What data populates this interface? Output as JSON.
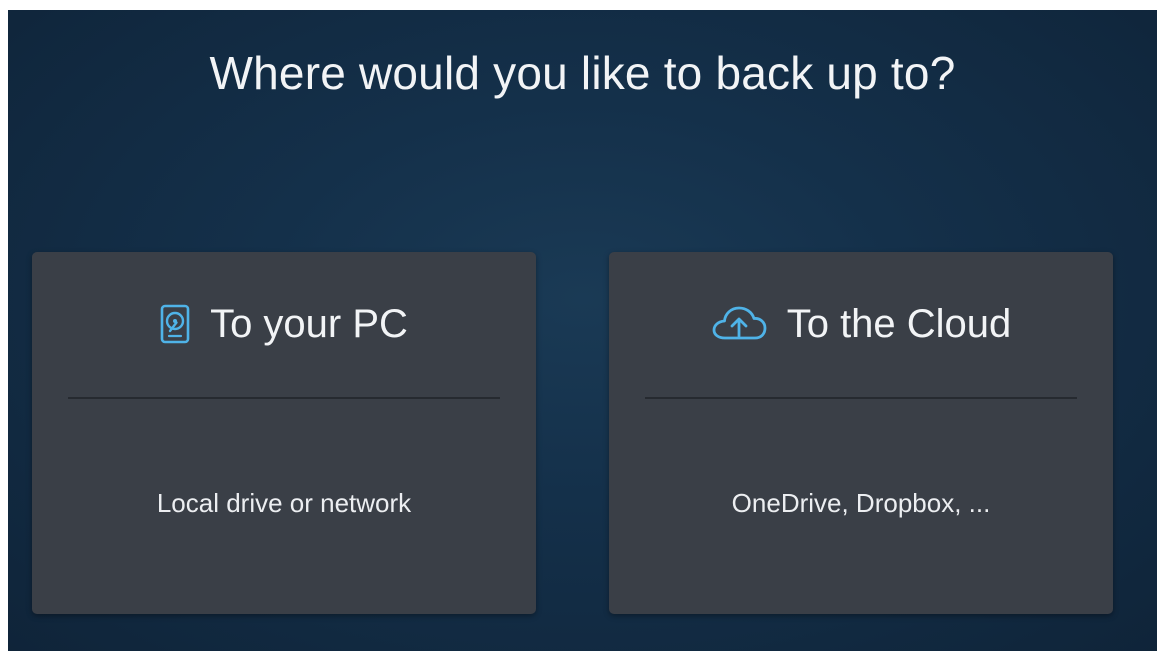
{
  "heading": "Where would you like to back up to?",
  "options": [
    {
      "title": "To your PC",
      "description": "Local drive or network",
      "icon": "hard-drive-icon"
    },
    {
      "title": "To the Cloud",
      "description": "OneDrive, Dropbox, ...",
      "icon": "cloud-upload-icon"
    }
  ],
  "colors": {
    "background": "#14304a",
    "card": "#3a3f47",
    "icon_accent": "#4fb3e8",
    "text": "#f2f4f6"
  }
}
